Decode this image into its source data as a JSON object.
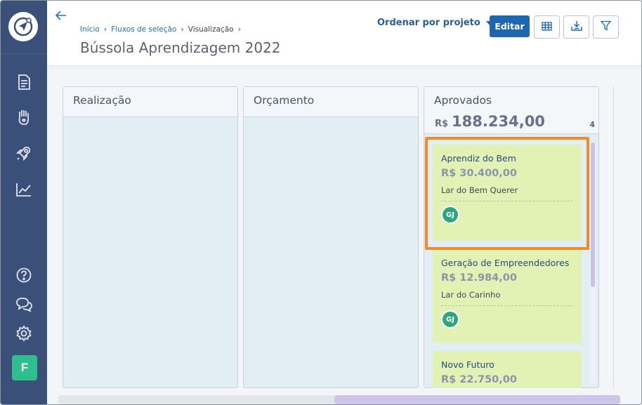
{
  "sidebar": {
    "logo": "compass-logo-icon",
    "nav_icons": [
      "document-list-icon",
      "hand-heart-icon",
      "rocket-icon",
      "chart-line-icon"
    ],
    "bottom_icons": [
      "help-circle-icon",
      "chat-bubbles-icon",
      "gear-icon"
    ],
    "user_initial": "F",
    "user_color": "#2fbf8f"
  },
  "header": {
    "breadcrumb": {
      "home": "Início",
      "flows": "Fluxos de seleção",
      "current": "Visualização"
    },
    "title": "Bússola Aprendizagem 2022",
    "sort_label": "Ordenar por projeto",
    "edit_label": "Editar",
    "tools": [
      "table-icon",
      "download-icon",
      "filter-icon"
    ],
    "accent": "#1d67b0"
  },
  "board": {
    "columns": [
      {
        "name": "Realização"
      },
      {
        "name": "Orçamento"
      },
      {
        "name": "Aprovados",
        "total_currency": "R$",
        "total_amount": "188.234,00",
        "count": "4",
        "cards": [
          {
            "title": "Aprendiz do Bem",
            "value": "R$ 30.400,00",
            "org": "Lar do Bem Querer",
            "avatar": "GJ"
          },
          {
            "title": "Geração de Empreendedores",
            "value": "R$ 12.984,00",
            "org": "Lar do Carinho",
            "avatar": "GJ"
          },
          {
            "title": "Novo Futuro",
            "value": "R$ 22.750,00"
          }
        ]
      }
    ],
    "card_color": "#e2f2b5",
    "highlight_color": "#f28a26"
  }
}
